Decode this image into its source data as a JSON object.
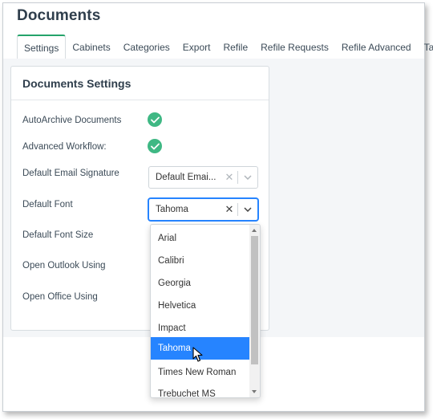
{
  "page": {
    "title": "Documents"
  },
  "tabs": [
    {
      "label": "Settings",
      "active": true
    },
    {
      "label": "Cabinets"
    },
    {
      "label": "Categories"
    },
    {
      "label": "Export"
    },
    {
      "label": "Refile"
    },
    {
      "label": "Refile Requests"
    },
    {
      "label": "Refile Advanced"
    },
    {
      "label": "Tags"
    }
  ],
  "card": {
    "title": "Documents Settings",
    "autoarchive": {
      "label": "AutoArchive Documents",
      "value": true,
      "icon": "check-circle-icon"
    },
    "advanced_workflow": {
      "label": "Advanced Workflow:",
      "value": true,
      "icon": "check-circle-icon"
    },
    "email_signature": {
      "label": "Default Email Signature",
      "value": "Default Emai..."
    },
    "font": {
      "label": "Default Font",
      "value": "Tahoma"
    },
    "font_size": {
      "label": "Default Font Size"
    },
    "open_outlook": {
      "label": "Open Outlook Using"
    },
    "open_office": {
      "label": "Open Office Using"
    }
  },
  "font_dropdown": {
    "options": [
      "Arial",
      "Calibri",
      "Georgia",
      "Helvetica",
      "Impact",
      "Tahoma",
      "Times New Roman",
      "Trebuchet MS"
    ],
    "selected": "Tahoma"
  },
  "colors": {
    "accent_green": "#25a36a",
    "check_green": "#3fb884",
    "selection_blue": "#2684ff"
  }
}
